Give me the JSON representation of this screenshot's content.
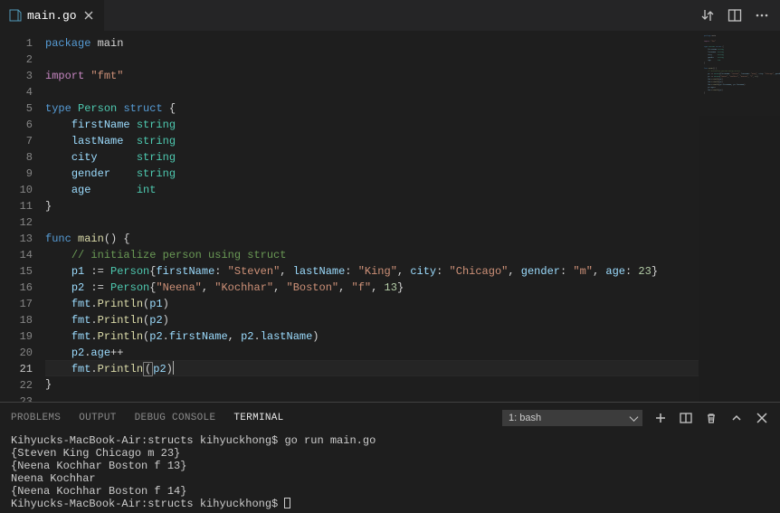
{
  "tab": {
    "filename": "main.go"
  },
  "titleActions": [
    "source-control",
    "split-editor",
    "more"
  ],
  "code": {
    "activeLine": 21,
    "lines": [
      [
        {
          "t": "package ",
          "c": "kw"
        },
        {
          "t": "main",
          "c": "pl"
        }
      ],
      [],
      [
        {
          "t": "import ",
          "c": "kw2"
        },
        {
          "t": "\"fmt\"",
          "c": "str"
        }
      ],
      [],
      [
        {
          "t": "type ",
          "c": "kw"
        },
        {
          "t": "Person ",
          "c": "typ"
        },
        {
          "t": "struct ",
          "c": "kw"
        },
        {
          "t": "{",
          "c": "pl"
        }
      ],
      [
        {
          "t": "    ",
          "c": "pl"
        },
        {
          "t": "firstName ",
          "c": "id"
        },
        {
          "t": "string",
          "c": "typ"
        }
      ],
      [
        {
          "t": "    ",
          "c": "pl"
        },
        {
          "t": "lastName  ",
          "c": "id"
        },
        {
          "t": "string",
          "c": "typ"
        }
      ],
      [
        {
          "t": "    ",
          "c": "pl"
        },
        {
          "t": "city      ",
          "c": "id"
        },
        {
          "t": "string",
          "c": "typ"
        }
      ],
      [
        {
          "t": "    ",
          "c": "pl"
        },
        {
          "t": "gender    ",
          "c": "id"
        },
        {
          "t": "string",
          "c": "typ"
        }
      ],
      [
        {
          "t": "    ",
          "c": "pl"
        },
        {
          "t": "age       ",
          "c": "id"
        },
        {
          "t": "int",
          "c": "typ"
        }
      ],
      [
        {
          "t": "}",
          "c": "pl"
        }
      ],
      [],
      [
        {
          "t": "func ",
          "c": "kw"
        },
        {
          "t": "main",
          "c": "fn"
        },
        {
          "t": "() {",
          "c": "pl"
        }
      ],
      [
        {
          "t": "    ",
          "c": "pl"
        },
        {
          "t": "// initialize person using struct",
          "c": "cm"
        }
      ],
      [
        {
          "t": "    ",
          "c": "pl"
        },
        {
          "t": "p1 ",
          "c": "id"
        },
        {
          "t": ":= ",
          "c": "pl"
        },
        {
          "t": "Person",
          "c": "typ"
        },
        {
          "t": "{",
          "c": "pl"
        },
        {
          "t": "firstName",
          "c": "id"
        },
        {
          "t": ": ",
          "c": "pl"
        },
        {
          "t": "\"Steven\"",
          "c": "str"
        },
        {
          "t": ", ",
          "c": "pl"
        },
        {
          "t": "lastName",
          "c": "id"
        },
        {
          "t": ": ",
          "c": "pl"
        },
        {
          "t": "\"King\"",
          "c": "str"
        },
        {
          "t": ", ",
          "c": "pl"
        },
        {
          "t": "city",
          "c": "id"
        },
        {
          "t": ": ",
          "c": "pl"
        },
        {
          "t": "\"Chicago\"",
          "c": "str"
        },
        {
          "t": ", ",
          "c": "pl"
        },
        {
          "t": "gender",
          "c": "id"
        },
        {
          "t": ": ",
          "c": "pl"
        },
        {
          "t": "\"m\"",
          "c": "str"
        },
        {
          "t": ", ",
          "c": "pl"
        },
        {
          "t": "age",
          "c": "id"
        },
        {
          "t": ": ",
          "c": "pl"
        },
        {
          "t": "23",
          "c": "num"
        },
        {
          "t": "}",
          "c": "pl"
        }
      ],
      [
        {
          "t": "    ",
          "c": "pl"
        },
        {
          "t": "p2 ",
          "c": "id"
        },
        {
          "t": ":= ",
          "c": "pl"
        },
        {
          "t": "Person",
          "c": "typ"
        },
        {
          "t": "{",
          "c": "pl"
        },
        {
          "t": "\"Neena\"",
          "c": "str"
        },
        {
          "t": ", ",
          "c": "pl"
        },
        {
          "t": "\"Kochhar\"",
          "c": "str"
        },
        {
          "t": ", ",
          "c": "pl"
        },
        {
          "t": "\"Boston\"",
          "c": "str"
        },
        {
          "t": ", ",
          "c": "pl"
        },
        {
          "t": "\"f\"",
          "c": "str"
        },
        {
          "t": ", ",
          "c": "pl"
        },
        {
          "t": "13",
          "c": "num"
        },
        {
          "t": "}",
          "c": "pl"
        }
      ],
      [
        {
          "t": "    ",
          "c": "pl"
        },
        {
          "t": "fmt",
          "c": "id"
        },
        {
          "t": ".",
          "c": "pl"
        },
        {
          "t": "Println",
          "c": "fn"
        },
        {
          "t": "(",
          "c": "pl"
        },
        {
          "t": "p1",
          "c": "id"
        },
        {
          "t": ")",
          "c": "pl"
        }
      ],
      [
        {
          "t": "    ",
          "c": "pl"
        },
        {
          "t": "fmt",
          "c": "id"
        },
        {
          "t": ".",
          "c": "pl"
        },
        {
          "t": "Println",
          "c": "fn"
        },
        {
          "t": "(",
          "c": "pl"
        },
        {
          "t": "p2",
          "c": "id"
        },
        {
          "t": ")",
          "c": "pl"
        }
      ],
      [
        {
          "t": "    ",
          "c": "pl"
        },
        {
          "t": "fmt",
          "c": "id"
        },
        {
          "t": ".",
          "c": "pl"
        },
        {
          "t": "Println",
          "c": "fn"
        },
        {
          "t": "(",
          "c": "pl"
        },
        {
          "t": "p2",
          "c": "id"
        },
        {
          "t": ".",
          "c": "pl"
        },
        {
          "t": "firstName",
          "c": "id"
        },
        {
          "t": ", ",
          "c": "pl"
        },
        {
          "t": "p2",
          "c": "id"
        },
        {
          "t": ".",
          "c": "pl"
        },
        {
          "t": "lastName",
          "c": "id"
        },
        {
          "t": ")",
          "c": "pl"
        }
      ],
      [
        {
          "t": "    ",
          "c": "pl"
        },
        {
          "t": "p2",
          "c": "id"
        },
        {
          "t": ".",
          "c": "pl"
        },
        {
          "t": "age",
          "c": "id"
        },
        {
          "t": "++",
          "c": "pl"
        }
      ],
      [
        {
          "t": "    ",
          "c": "pl"
        },
        {
          "t": "fmt",
          "c": "id"
        },
        {
          "t": ".",
          "c": "pl"
        },
        {
          "t": "Println",
          "c": "fn"
        },
        {
          "t": "(",
          "c": "pl",
          "box": true
        },
        {
          "t": "p2",
          "c": "id"
        },
        {
          "t": ")",
          "c": "pl",
          "caret": true
        }
      ],
      [
        {
          "t": "}",
          "c": "pl"
        }
      ],
      []
    ]
  },
  "panel": {
    "tabs": {
      "problems": "PROBLEMS",
      "output": "OUTPUT",
      "debug": "DEBUG CONSOLE",
      "terminal": "TERMINAL"
    },
    "terminalSelect": "1: bash",
    "terminalLines": [
      "Kihyucks-MacBook-Air:structs kihyuckhong$ go run main.go",
      "{Steven King Chicago m 23}",
      "{Neena Kochhar Boston f 13}",
      "Neena Kochhar",
      "{Neena Kochhar Boston f 14}",
      "Kihyucks-MacBook-Air:structs kihyuckhong$ "
    ]
  }
}
